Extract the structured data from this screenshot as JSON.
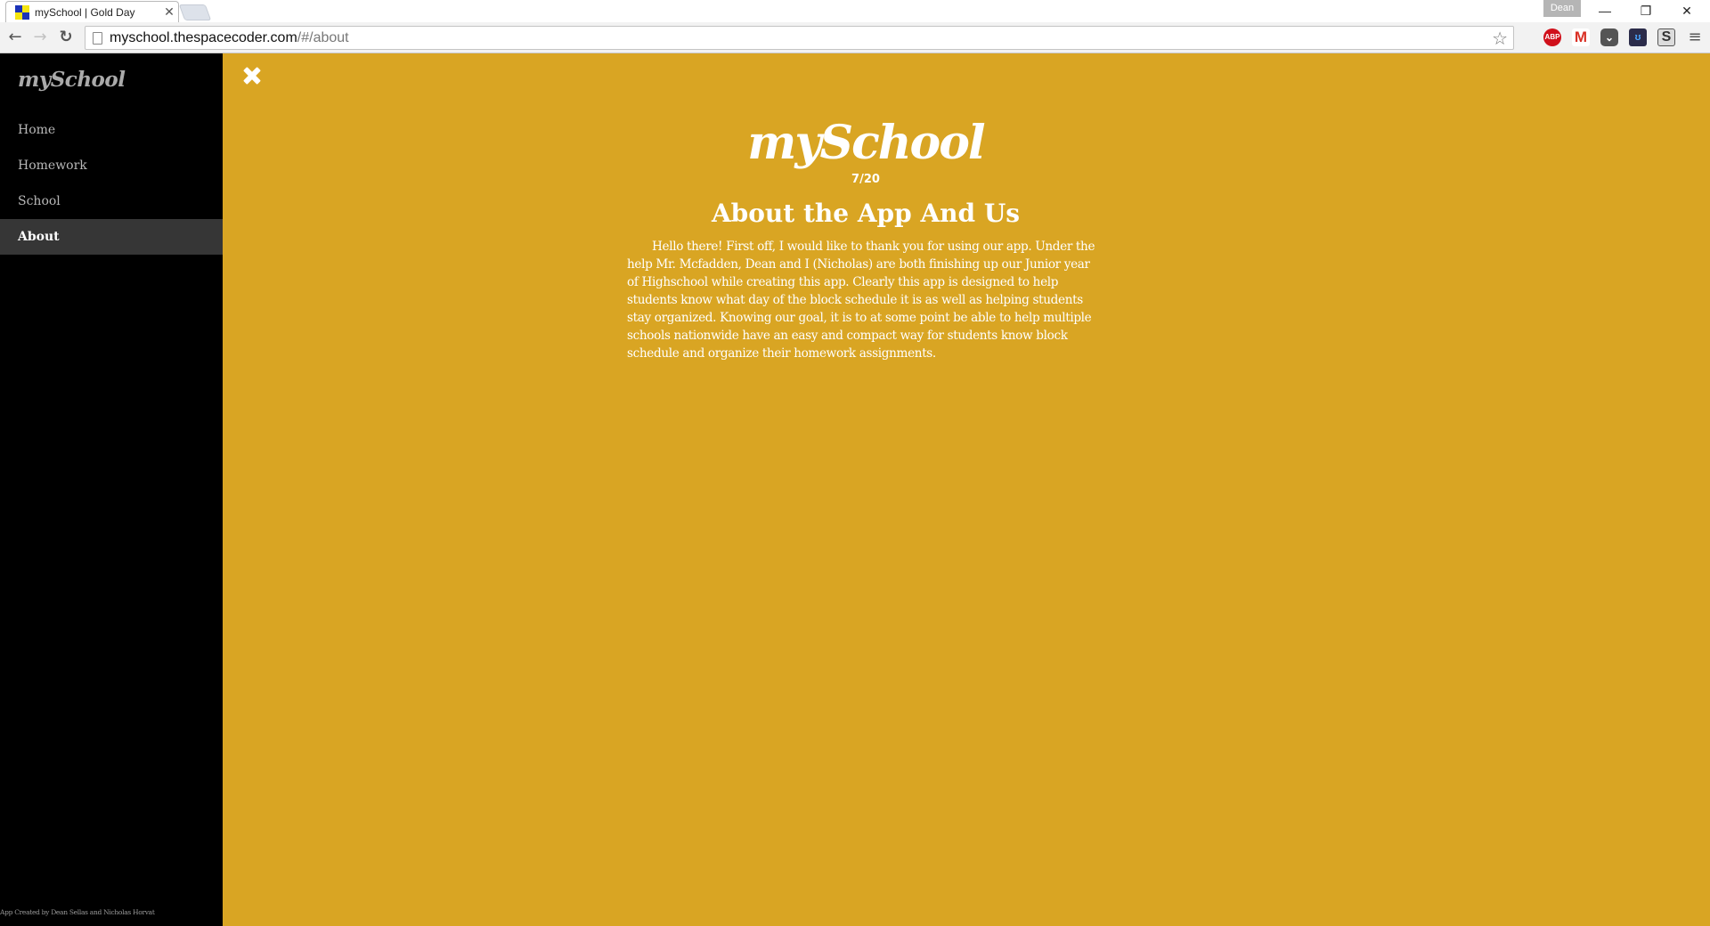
{
  "browser": {
    "tab_title": "mySchool | Gold Day",
    "tab_close": "✕",
    "profile_name": "Dean",
    "window_controls": {
      "minimize": "—",
      "restore": "❐",
      "close": "✕"
    },
    "nav_icons": {
      "back": "←",
      "forward": "→",
      "reload": "↻"
    },
    "url_host": "myschool.thespacecoder.com",
    "url_path": "/#/about",
    "bookmark_star": "☆",
    "extensions": [
      {
        "name": "adblock-plus",
        "label": "ABP"
      },
      {
        "name": "gmail",
        "label": "M"
      },
      {
        "name": "pocket",
        "label": "⌄"
      },
      {
        "name": "u-extension",
        "label": "ʊ"
      },
      {
        "name": "s-extension",
        "label": "S"
      }
    ],
    "menu_icon": "≡"
  },
  "sidebar": {
    "brand": "mySchool",
    "items": [
      {
        "label": "Home",
        "active": false
      },
      {
        "label": "Homework",
        "active": false
      },
      {
        "label": "School",
        "active": false
      },
      {
        "label": "About",
        "active": true
      }
    ],
    "credit": "App Created by Dean Sellas and Nicholas Horvat"
  },
  "main": {
    "logo": "mySchool",
    "date": "7/20",
    "heading": "About the App And Us",
    "body": "Hello there! First off, I would like to thank you for using our app. Under the help Mr. Mcfadden, Dean and I (Nicholas) are both finishing up our Junior year of Highschool while creating this app. Clearly this app is designed to help students know what day of the block schedule it is as well as helping students stay organized. Knowing our goal, it is to at some point be able to help multiple schools nationwide have an easy and compact way for students know block schedule and organize their homework assignments."
  },
  "colors": {
    "page_background": "#d9a523",
    "sidebar_background": "#000000",
    "sidebar_active": "#363636"
  }
}
